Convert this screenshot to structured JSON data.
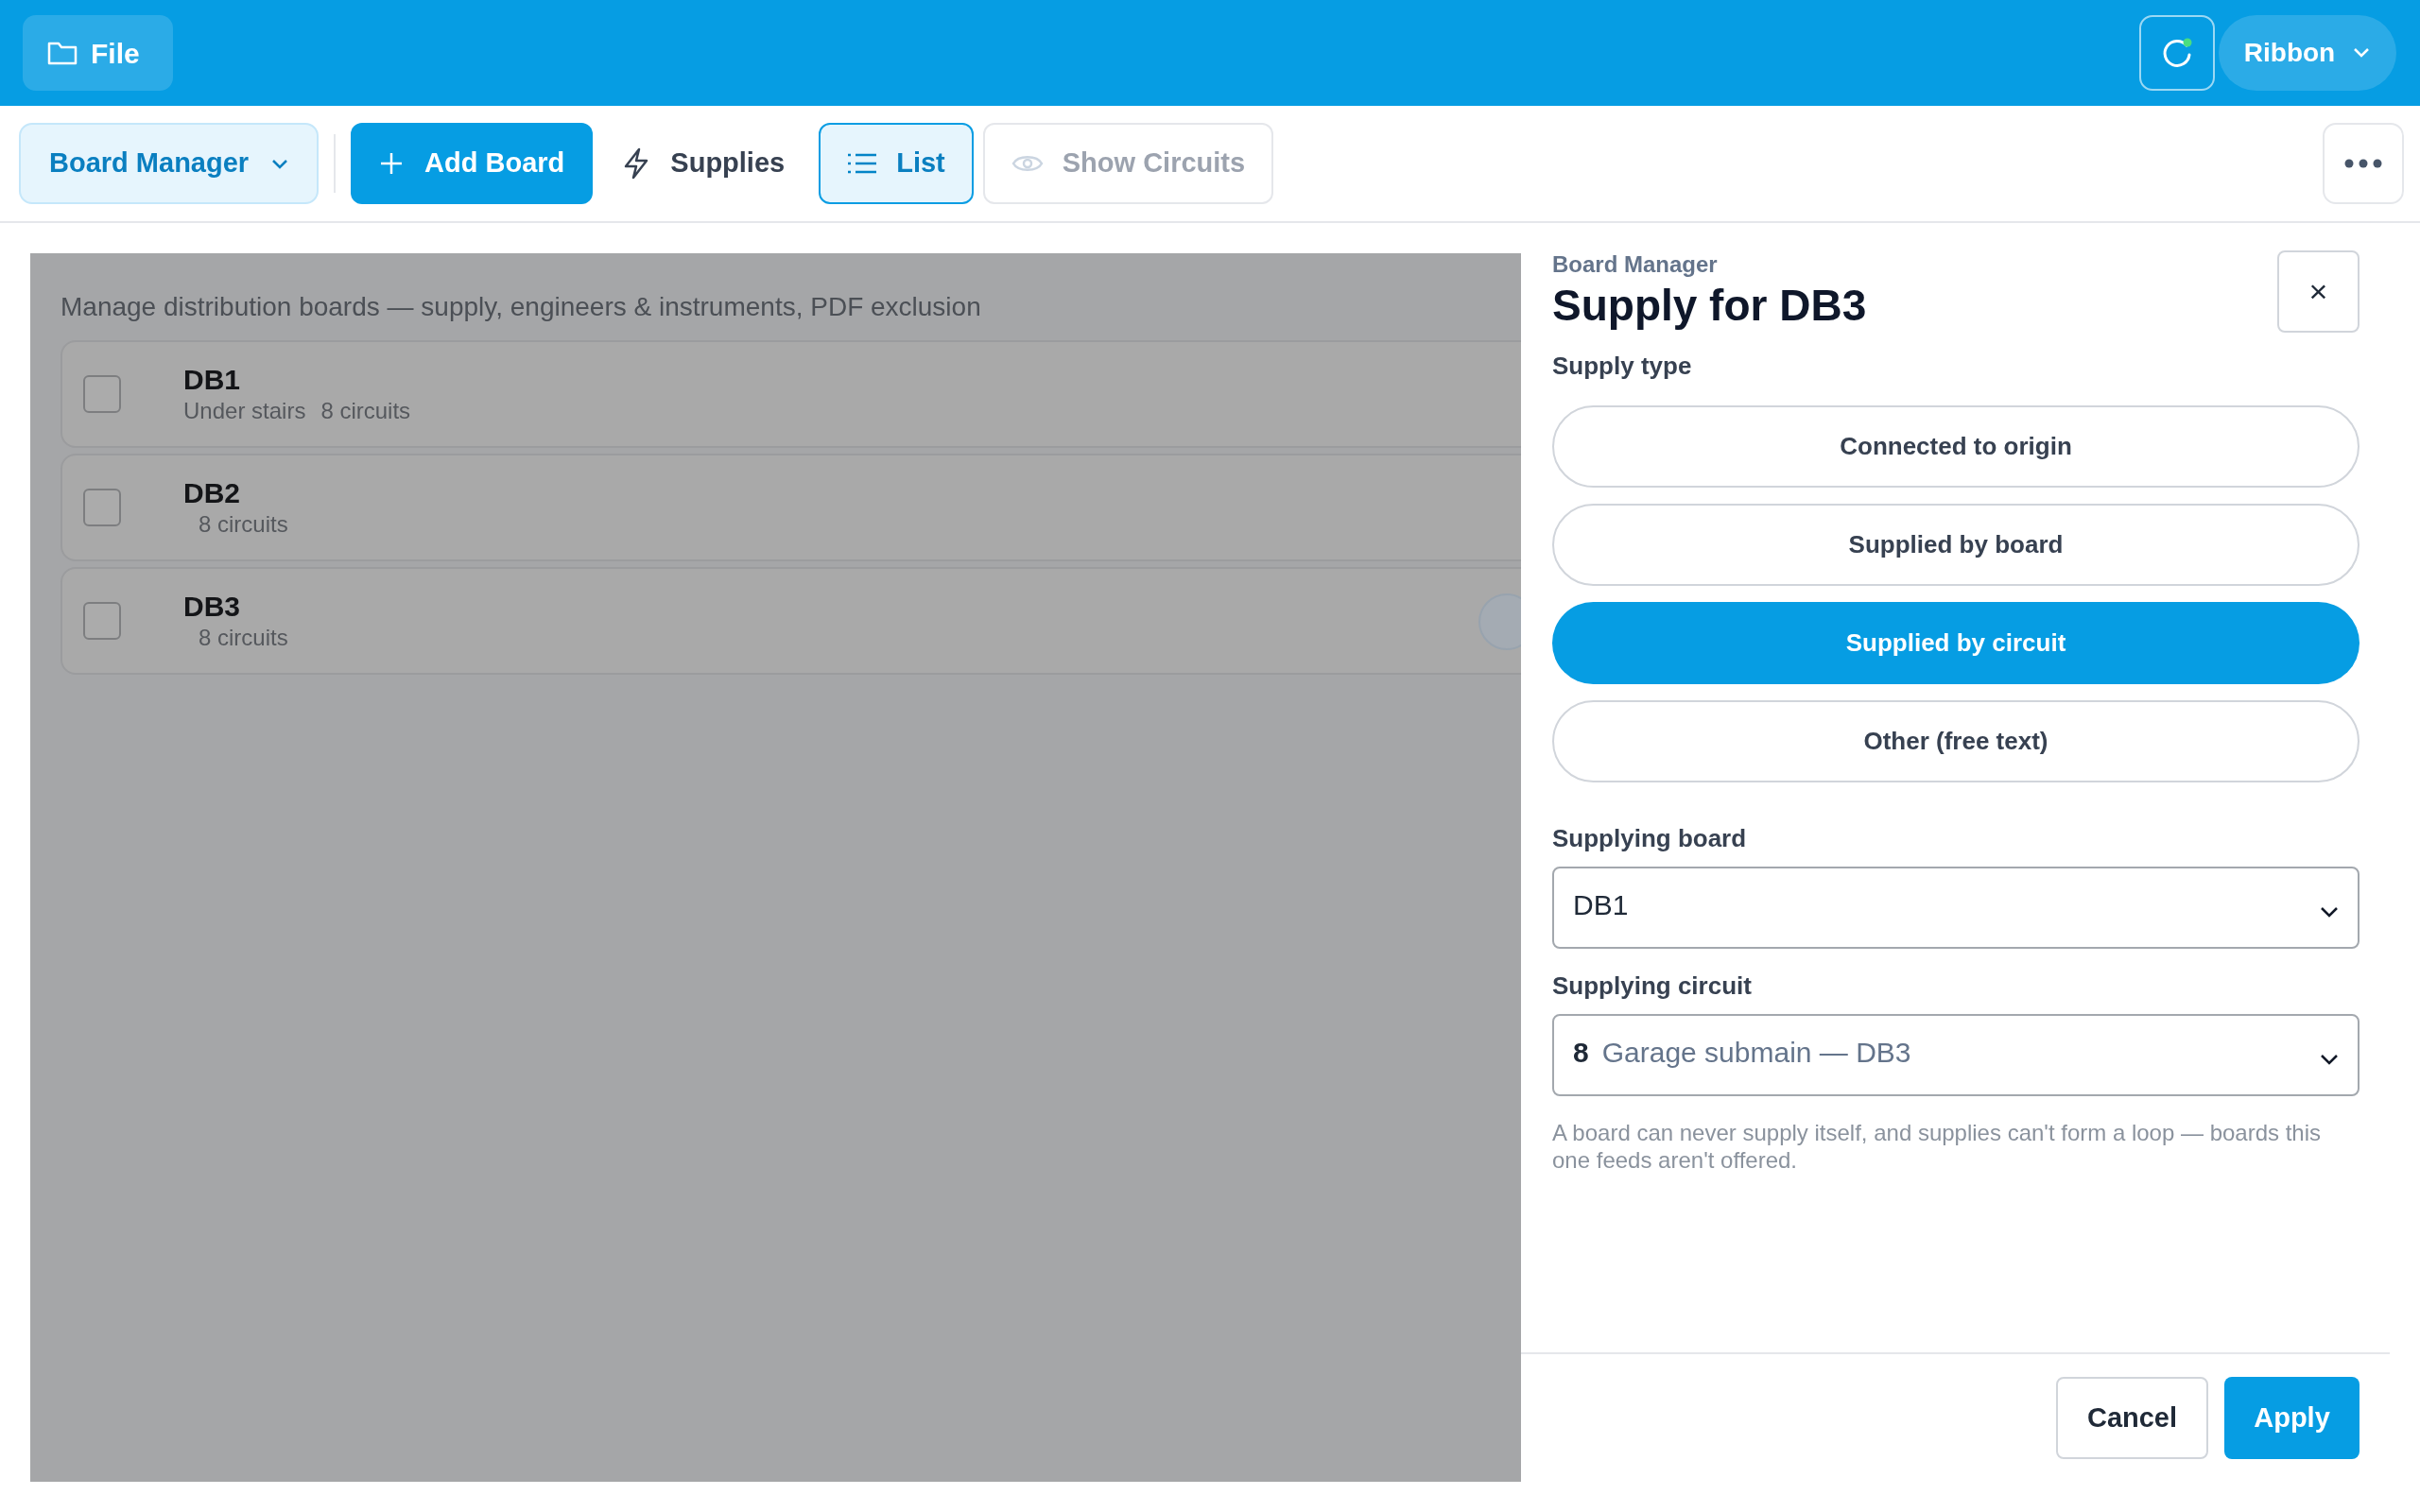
{
  "top_bar": {
    "file_button": "File",
    "ribbon_button": "Ribbon"
  },
  "toolbar": [
    {
      "kind": "dropdown",
      "label": "Board Manager"
    },
    {
      "kind": "primary",
      "label": "Add Board"
    },
    {
      "kind": "plain",
      "label": "Supplies"
    },
    {
      "kind": "toggle",
      "label": "List",
      "selected": true
    },
    {
      "kind": "toggle",
      "label": "Show Circuits",
      "selected": false
    }
  ],
  "boards_intro": "Manage distribution boards — supply, engineers & instruments, PDF exclusion",
  "boards": [
    {
      "name": "DB1",
      "location": "Under stairs",
      "circuits": "8 circuits",
      "checked": false
    },
    {
      "name": "DB2",
      "circuits": "8 circuits",
      "checked": false
    },
    {
      "name": "DB3",
      "circuits": "8 circuits",
      "checked": false
    }
  ],
  "panel": {
    "breadcrumb": "Board Manager",
    "title": "Supply for DB3",
    "close": "×",
    "supply_type_label": "Supply type",
    "options": [
      {
        "label": "Connected to origin",
        "selected": false
      },
      {
        "label": "Supplied by board",
        "selected": false
      },
      {
        "label": "Supplied by circuit",
        "selected": true
      },
      {
        "label": "Other (free text)",
        "selected": false
      }
    ],
    "fields": [
      {
        "label": "Supplying board",
        "value": "DB1"
      },
      {
        "label": "Supplying circuit",
        "number": "8",
        "value": "Garage submain — DB3"
      }
    ],
    "hint": "A board can never supply itself, and supplies can't form a loop — boards this one feeds aren't offered.",
    "buttons": [
      {
        "kind": "secondary",
        "label": "Cancel"
      },
      {
        "kind": "primary",
        "label": "Apply"
      }
    ]
  }
}
